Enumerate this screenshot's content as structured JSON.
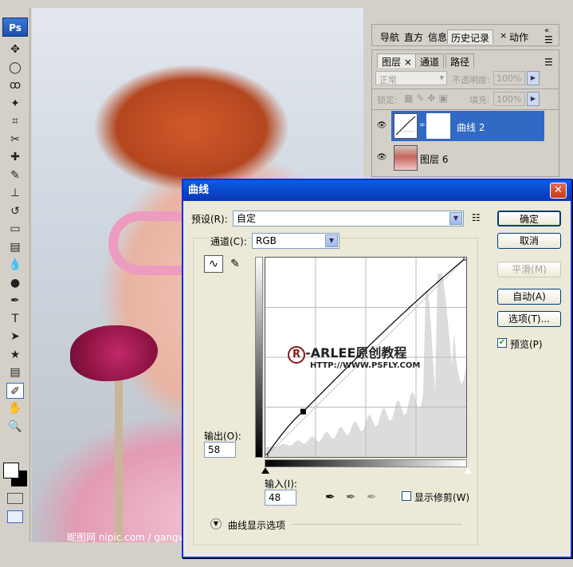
{
  "app": {
    "logo_label": "Ps",
    "tools": [
      "move-icon",
      "marquee-icon",
      "lasso-icon",
      "magic-wand-icon",
      "crop-icon",
      "slice-icon",
      "healing-brush-icon",
      "brush-icon",
      "clone-stamp-icon",
      "history-brush-icon",
      "eraser-icon",
      "gradient-icon",
      "blur-icon",
      "dodge-icon",
      "pen-icon",
      "type-icon",
      "path-selection-icon",
      "shape-icon",
      "notes-icon",
      "eyedropper-icon",
      "hand-icon",
      "zoom-icon"
    ]
  },
  "photo": {
    "watermark": "昵图网 nipic.com / gangwang"
  },
  "panel_nav": {
    "tabs": [
      "导航",
      "直方",
      "信息",
      "历史记录",
      "动作"
    ]
  },
  "panel_layers": {
    "tabs": [
      "图层",
      "通道",
      "路径"
    ],
    "blend_mode": "正常",
    "opacity_label": "不透明度:",
    "opacity_value": "100%",
    "lock_label": "锁定:",
    "fill_label": "填充:",
    "fill_value": "100%",
    "layers": [
      {
        "name": "曲线 2",
        "selected": true
      },
      {
        "name": "图层 6",
        "selected": false
      }
    ]
  },
  "dialog": {
    "title": "曲线",
    "preset_label": "预设(R):",
    "preset_value": "自定",
    "channel_label": "通道(C):",
    "channel_value": "RGB",
    "output_label": "输出(O):",
    "output_value": "58",
    "input_label": "输入(I):",
    "input_value": "48",
    "buttons": {
      "ok": "确定",
      "cancel": "取消",
      "smooth": "平滑(M)",
      "auto": "自动(A)",
      "options": "选项(T)..."
    },
    "preview_label": "预览(P)",
    "preview_checked": true,
    "show_clipping_label": "显示修剪(W)",
    "show_clipping_checked": false,
    "curve_options_label": "曲线显示选项",
    "overlay_brand": "-ARLEE原创教程",
    "overlay_url": "HTTP://WWW.PSFLY.COM"
  },
  "chart_data": {
    "type": "line",
    "x": [
      0,
      48,
      255
    ],
    "values": [
      0,
      58,
      255
    ],
    "xlabel": "输入(I):",
    "ylabel": "输出(O):",
    "xlim": [
      0,
      255
    ],
    "ylim": [
      0,
      255
    ],
    "grid": true
  }
}
